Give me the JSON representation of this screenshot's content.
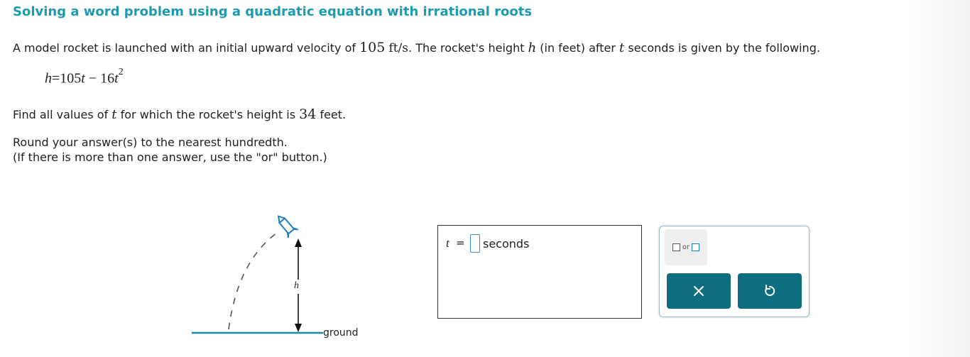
{
  "title": "Solving a word problem using a quadratic equation with irrational roots",
  "intro": {
    "before_velocity": "A model rocket is launched with an initial upward velocity of",
    "velocity": "105",
    "velocity_unit": "ft/s",
    "after_velocity": ". The rocket's height",
    "h_var": "h",
    "after_h": "(in feet) after",
    "t_var": "t",
    "after_t": "seconds is given by the following."
  },
  "equation": {
    "lhs": "h",
    "equals": "=",
    "coef1": "105",
    "var1": "t",
    "minus": "−",
    "coef2": "16",
    "var2": "t",
    "exponent": "2"
  },
  "question": {
    "before_t": "Find all values of",
    "t_var": "t",
    "middle": "for which the rocket's height is",
    "height": "34",
    "after": "feet."
  },
  "instructions": {
    "line1": "Round your answer(s) to the nearest hundredth.",
    "line2": "(If there is more than one answer, use the \"or\" button.)"
  },
  "diagram": {
    "h_label": "h",
    "ground_label": "ground"
  },
  "answer": {
    "variable": "t",
    "equals": "=",
    "value": "",
    "unit": "seconds"
  },
  "toolbox": {
    "or_label": "or",
    "clear_icon": "close-icon",
    "undo_icon": "undo-icon"
  },
  "colors": {
    "title": "#1e9ab0",
    "button": "#0e6e80",
    "diagram_line": "#1e8aa8",
    "input_border": "#3b8ed8"
  }
}
